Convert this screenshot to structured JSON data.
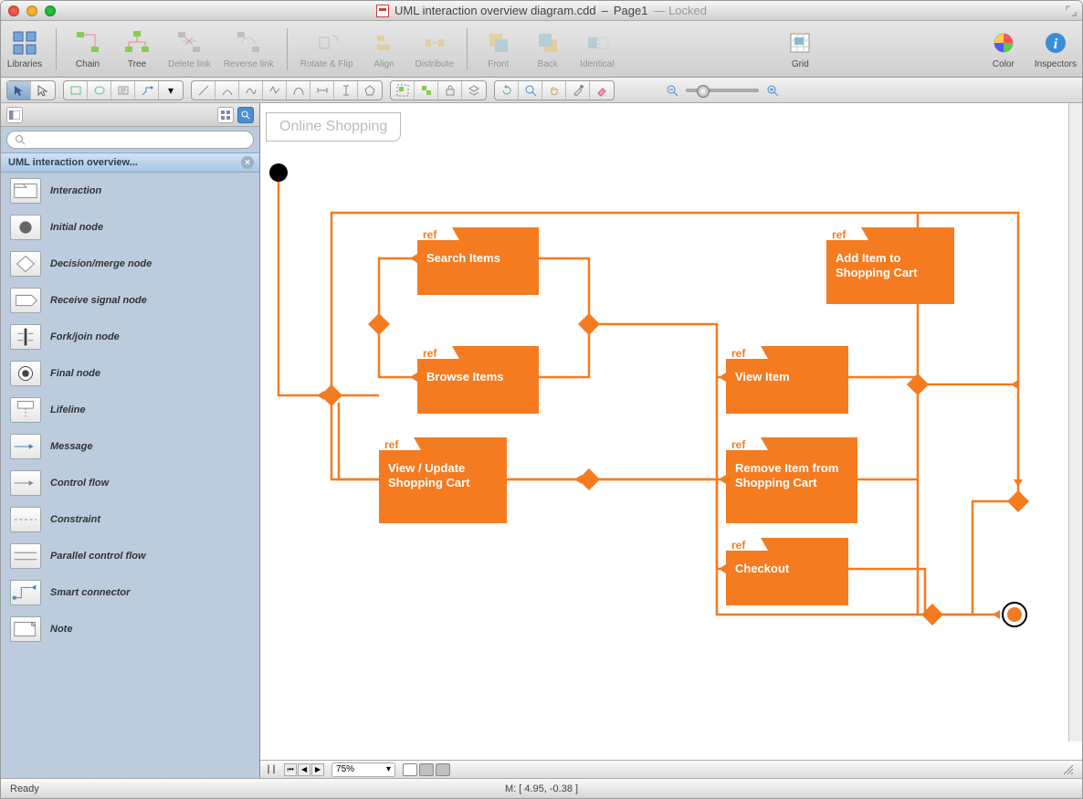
{
  "window": {
    "title_doc": "UML interaction overview diagram.cdd",
    "title_page": "Page1",
    "title_locked": "Locked"
  },
  "toolbar": {
    "items": [
      {
        "label": "Libraries",
        "disabled": false
      },
      {
        "label": "Chain",
        "disabled": false
      },
      {
        "label": "Tree",
        "disabled": false
      },
      {
        "label": "Delete link",
        "disabled": true
      },
      {
        "label": "Reverse link",
        "disabled": true
      },
      {
        "label": "Rotate & Flip",
        "disabled": true
      },
      {
        "label": "Align",
        "disabled": true
      },
      {
        "label": "Distribute",
        "disabled": true
      },
      {
        "label": "Front",
        "disabled": true
      },
      {
        "label": "Back",
        "disabled": true
      },
      {
        "label": "Identical",
        "disabled": true
      },
      {
        "label": "Grid",
        "disabled": false
      },
      {
        "label": "Color",
        "disabled": false
      },
      {
        "label": "Inspectors",
        "disabled": false
      }
    ]
  },
  "sidebar": {
    "group_title": "UML interaction overview...",
    "search_placeholder": "",
    "shapes": [
      {
        "label": "Interaction"
      },
      {
        "label": "Initial node"
      },
      {
        "label": "Decision/merge node"
      },
      {
        "label": "Receive signal node"
      },
      {
        "label": "Fork/join node"
      },
      {
        "label": "Final node"
      },
      {
        "label": "Lifeline"
      },
      {
        "label": "Message"
      },
      {
        "label": "Control flow"
      },
      {
        "label": "Constraint"
      },
      {
        "label": "Parallel control flow"
      },
      {
        "label": "Smart connector"
      },
      {
        "label": "Note"
      }
    ]
  },
  "diagram": {
    "title": "Online Shopping",
    "ref_tag": "ref",
    "nodes": [
      {
        "label": "Search Items"
      },
      {
        "label": "Browse Items"
      },
      {
        "label": "View / Update Shopping Cart"
      },
      {
        "label": "View Item"
      },
      {
        "label": "Add Item to Shopping Cart"
      },
      {
        "label": "Remove Item from Shopping Cart"
      },
      {
        "label": "Checkout"
      }
    ]
  },
  "footer": {
    "zoom": "75%",
    "status_left": "Ready",
    "coords": "M: [ 4.95, -0.38 ]"
  }
}
